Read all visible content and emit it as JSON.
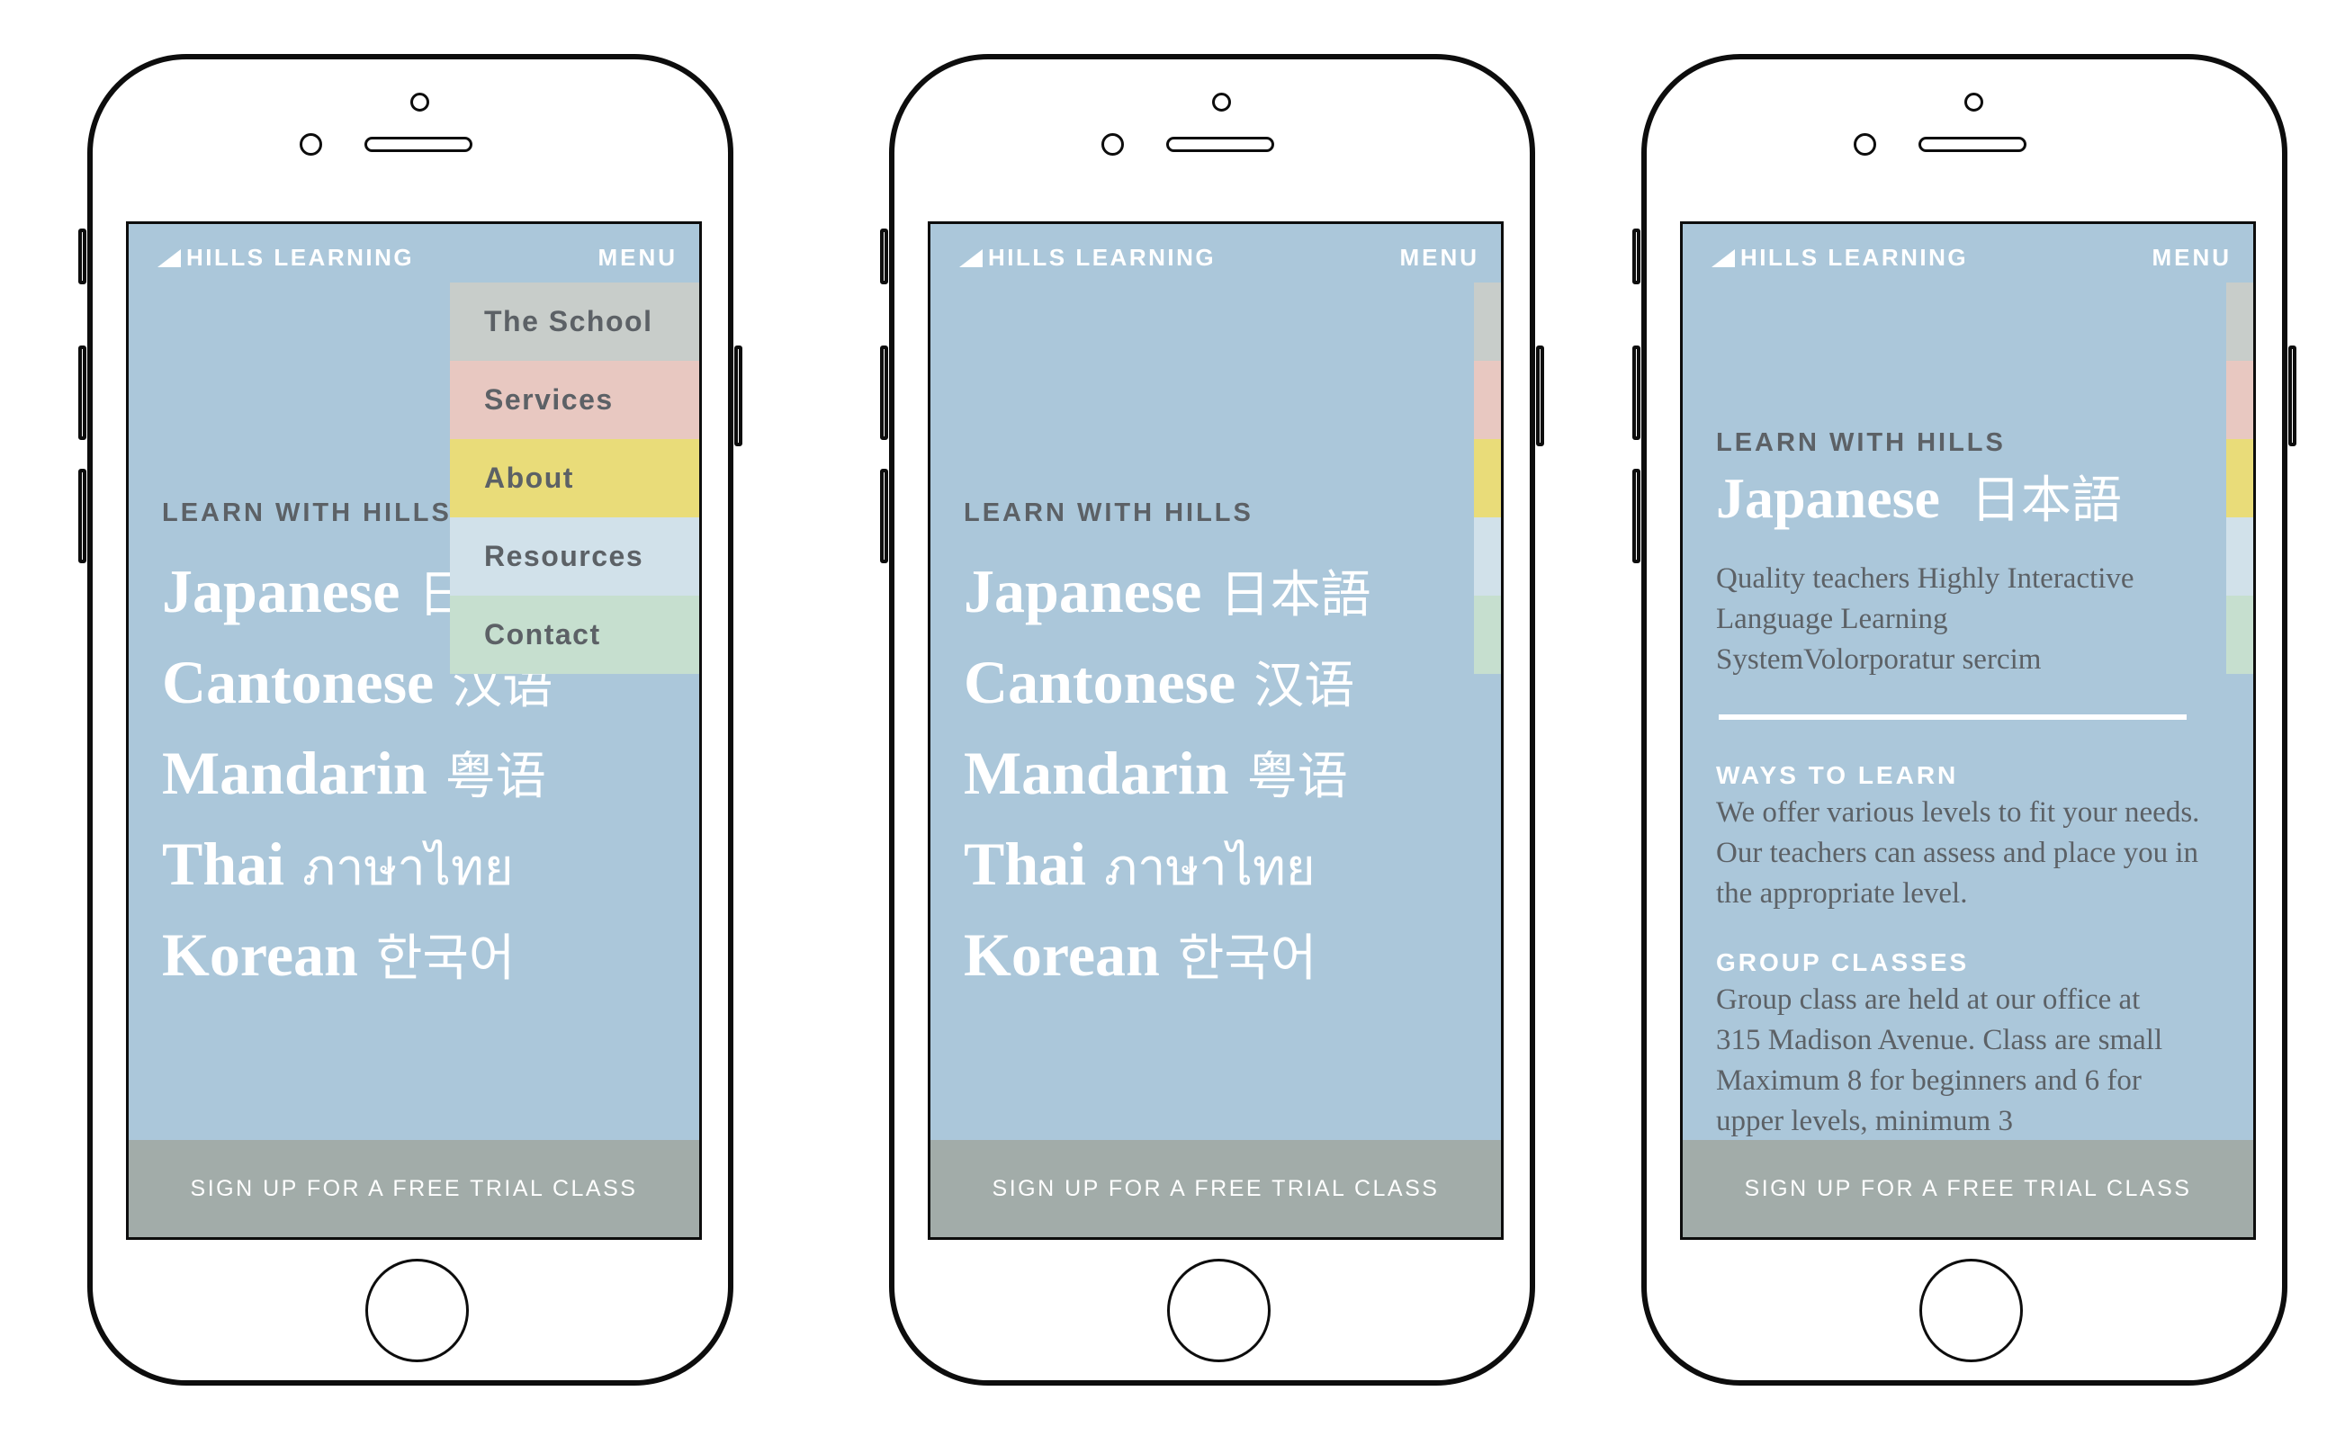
{
  "brand": "HILLS LEARNING",
  "menu_label": "MENU",
  "kicker": "LEARN WITH HILLS",
  "languages": [
    {
      "name": "Japanese",
      "native": "日本語"
    },
    {
      "name": "Cantonese",
      "native": "汉语"
    },
    {
      "name": "Mandarin",
      "native": "粤语"
    },
    {
      "name": "Thai",
      "native": "ภาษาไทย"
    },
    {
      "name": "Korean",
      "native": "한국어"
    }
  ],
  "cta": "SIGN UP FOR A FREE TRIAL CLASS",
  "menu_items": [
    {
      "label": "The School",
      "color": "#c8cdca"
    },
    {
      "label": "Services",
      "color": "#e8c8c1"
    },
    {
      "label": "About",
      "color": "#e9dc79"
    },
    {
      "label": "Resources",
      "color": "#d1e1ea"
    },
    {
      "label": "Contact",
      "color": "#c6dfcf"
    }
  ],
  "detail": {
    "intro": "Quality teachers Highly Interactive Language Learning SystemVolorporatur sercim",
    "sections": [
      {
        "title": "WAYS TO LEARN",
        "text": "We offer various levels to fit your needs. Our teachers can assess and place you in the appropriate level."
      },
      {
        "title": "GROUP CLASSES",
        "text": "Group class are held at our office at 315 Madison Avenue. Class are small Maximum 8 for beginners and 6 for upper levels, minimum 3"
      }
    ]
  },
  "colors": {
    "screen_bg": "#abc7da",
    "cta_bg": "#a2aca9",
    "heading_text": "#ffffff",
    "muted_text": "#5c6166"
  },
  "icons": {
    "brand": "triangle-logo-icon",
    "front_camera": "front-camera-icon",
    "earpiece": "earpiece-speaker-icon",
    "home": "home-button-icon"
  }
}
